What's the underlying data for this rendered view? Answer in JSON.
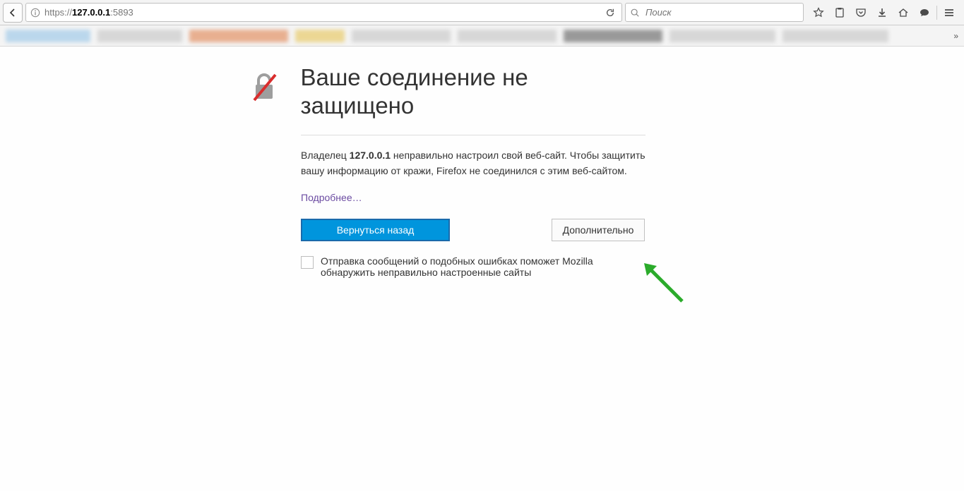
{
  "address": {
    "scheme": "https://",
    "host_bold": "127.0.0.1",
    "port": ":5893"
  },
  "search": {
    "placeholder": "Поиск"
  },
  "error": {
    "title": "Ваше соединение не защищено",
    "desc_pre": "Владелец ",
    "desc_host": "127.0.0.1",
    "desc_post": " неправильно настроил свой веб-сайт. Чтобы защитить вашу информацию от кражи, Firefox не соединился с этим веб-сайтом.",
    "learn_more": "Подробнее…",
    "go_back": "Вернуться назад",
    "advanced": "Дополнительно",
    "report": "Отправка сообщений о подобных ошибках поможет Mozilla обнаружить неправильно настроенные сайты"
  }
}
